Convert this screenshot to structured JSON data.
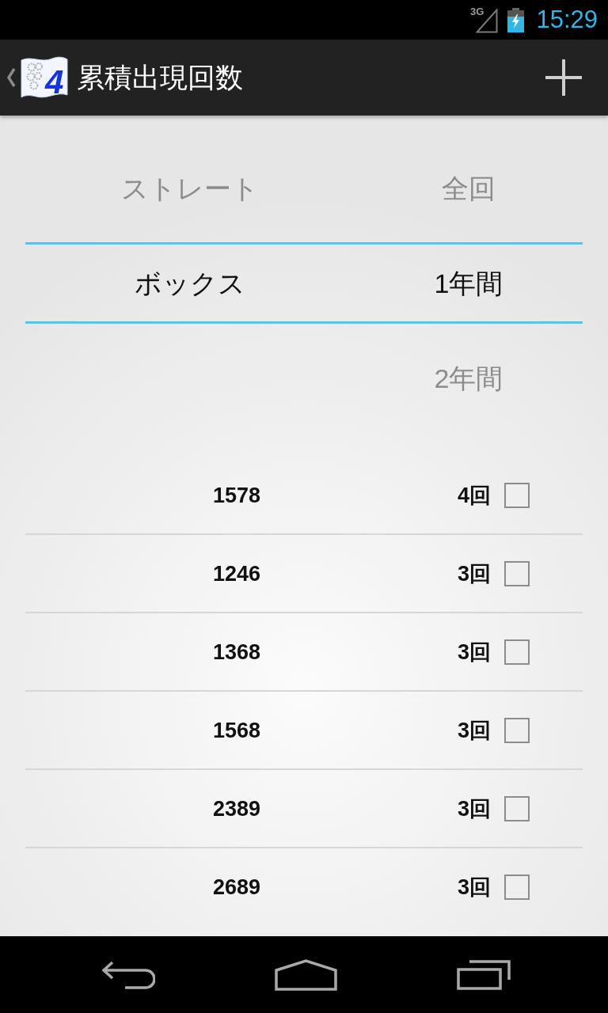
{
  "status_bar": {
    "network": "3G",
    "time": "15:29"
  },
  "action_bar": {
    "logo_text": "4",
    "title": "累積出現回数"
  },
  "pickers": [
    {
      "items": [
        {
          "label": "ストレート",
          "selected": false
        },
        {
          "label": "ボックス",
          "selected": true
        }
      ]
    },
    {
      "items": [
        {
          "label": "全回",
          "selected": false
        },
        {
          "label": "1年間",
          "selected": true
        },
        {
          "label": "2年間",
          "selected": false
        }
      ]
    }
  ],
  "results": [
    {
      "number": "1578",
      "count": "4回",
      "checked": false
    },
    {
      "number": "1246",
      "count": "3回",
      "checked": false
    },
    {
      "number": "1368",
      "count": "3回",
      "checked": false
    },
    {
      "number": "1568",
      "count": "3回",
      "checked": false
    },
    {
      "number": "2389",
      "count": "3回",
      "checked": false
    },
    {
      "number": "2689",
      "count": "3回",
      "checked": false
    }
  ]
}
